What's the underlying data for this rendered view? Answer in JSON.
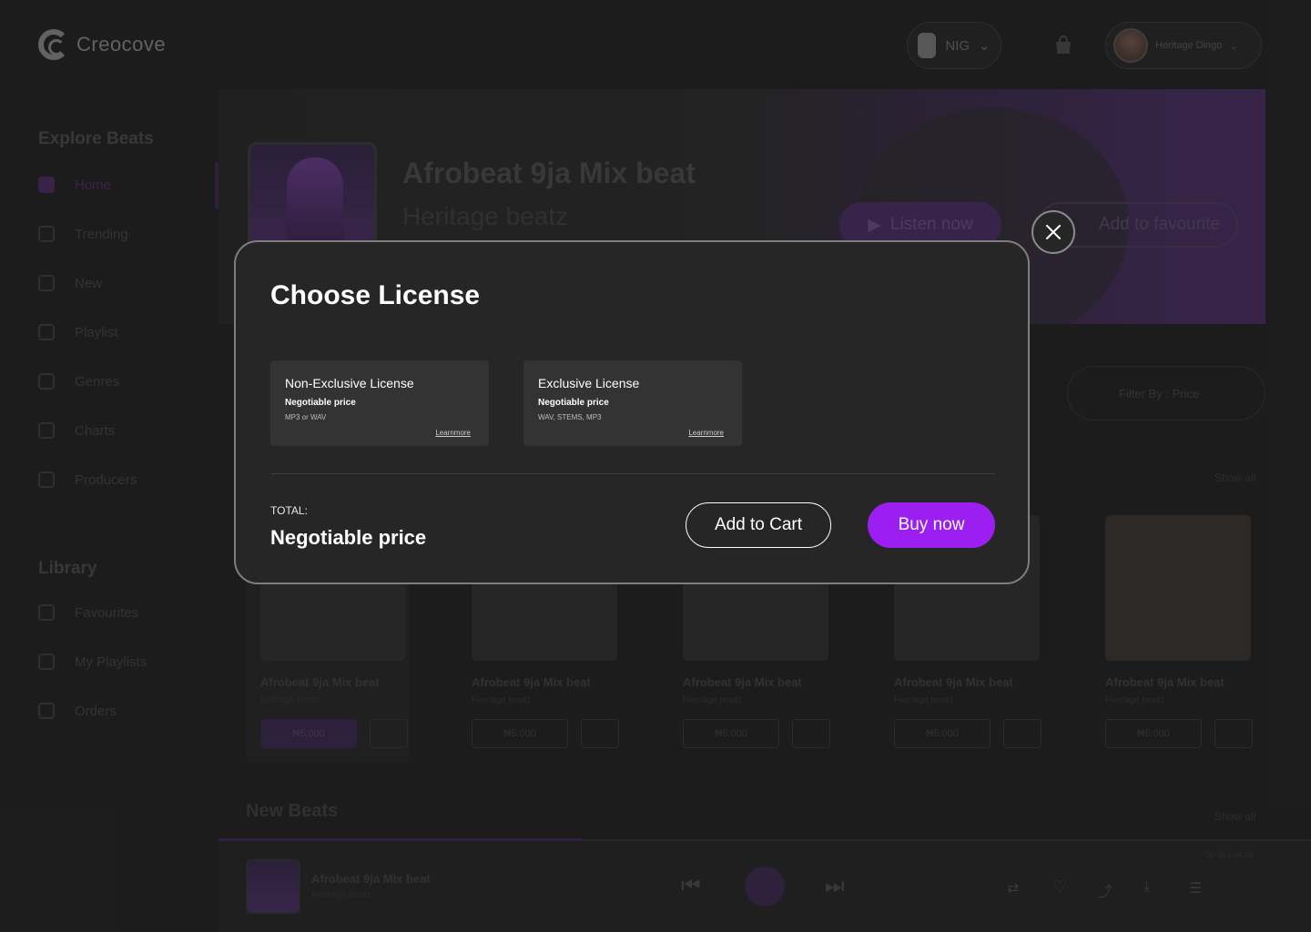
{
  "header": {
    "logo_text": "Creocove",
    "country": "NIG",
    "user_name": "Heritage Dingo"
  },
  "sidebar": {
    "explore_heading": "Explore Beats",
    "explore_items": [
      {
        "label": "Home"
      },
      {
        "label": "Trending"
      },
      {
        "label": "New"
      },
      {
        "label": "Playlist"
      },
      {
        "label": "Genres"
      },
      {
        "label": "Charts"
      },
      {
        "label": "Producers"
      }
    ],
    "library_heading": "Library",
    "library_items": [
      {
        "label": "Favourites"
      },
      {
        "label": "My Playlists"
      },
      {
        "label": "Orders"
      }
    ]
  },
  "hero": {
    "title": "Afrobeat 9ja Mix beat",
    "artist": "Heritage beatz",
    "listen_label": "Listen now",
    "favourite_label": "Add to favourite"
  },
  "filter": {
    "label": "Filter By : Price"
  },
  "show_all": "Show all",
  "beats": [
    {
      "title": "Afrobeat 9ja Mix beat",
      "artist": "Heritage beatz",
      "price": "₦5,000"
    },
    {
      "title": "Afrobeat 9ja Mix beat",
      "artist": "Heritage beatz",
      "price": "₦5,000"
    },
    {
      "title": "Afrobeat 9ja Mix beat",
      "artist": "Heritage beatz",
      "price": "₦5,000"
    },
    {
      "title": "Afrobeat 9ja Mix beat",
      "artist": "Heritage beatz",
      "price": "₦5,000"
    },
    {
      "title": "Afrobeat 9ja Mix beat",
      "artist": "Heritage beatz",
      "price": "₦5,000"
    }
  ],
  "new_beats_heading": "New Beats",
  "player": {
    "title": "Afrobeat 9ja Mix beat",
    "artist": "Heritage beatz",
    "time": "00:35 / 04:34"
  },
  "modal": {
    "title": "Choose License",
    "licenses": [
      {
        "name": "Non-Exclusive License",
        "price": "Negotiable price",
        "files": "MP3 or WAV",
        "learn_more": "Learnmore"
      },
      {
        "name": "Exclusive License",
        "price": "Negotiable price",
        "files": "WAV, STEMS, MP3",
        "learn_more": "Learnmore"
      }
    ],
    "total_label": "TOTAL:",
    "total_value": "Negotiable price",
    "add_to_cart_label": "Add to Cart",
    "buy_now_label": "Buy now"
  },
  "colors": {
    "accent": "#9a1ff0",
    "background": "#202020",
    "modal_bg": "#262626",
    "card_bg": "#333333"
  }
}
